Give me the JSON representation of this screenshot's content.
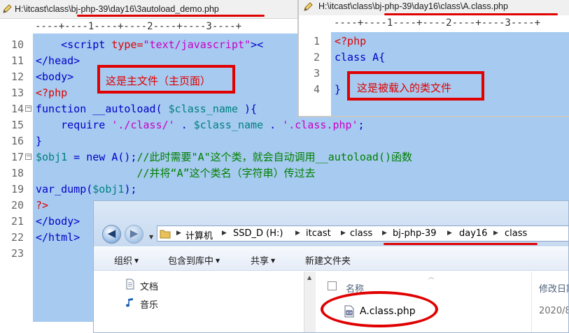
{
  "editor_main": {
    "title": "H:\\itcast\\class\\bj-php-39\\day16\\3autoload_demo.php",
    "ruler": "----+----1----+----2----+----3----+",
    "annotation": "这是主文件（主页面）",
    "line_numbers": [
      "10",
      "11",
      "12",
      "13",
      "14",
      "15",
      "16",
      "17",
      "18",
      "19",
      "20",
      "21",
      "22",
      "23"
    ],
    "lines": {
      "l10_indent": "    ",
      "l10_tag": "<script ",
      "l10_attr": "type=",
      "l10_str": "\"text/javascript\"",
      "l10_end": "><",
      "l11": "</head>",
      "l12": "<body>",
      "l13": "<?php",
      "l14_kw": "function",
      "l14_fn": " __autoload( ",
      "l14_var": "$class_name",
      "l14_end": " ){",
      "l15_kw": "    require ",
      "l15_str1": "'./class/'",
      "l15_dot": " . ",
      "l15_var": "$class_name",
      "l15_dot2": " . ",
      "l15_str2": "'.class.php'",
      "l15_end": ";",
      "l16": "}",
      "l17_var": "$obj1",
      "l17_mid": " = new A();",
      "l17_cmt": "//此时需要\"A\"这个类，就会自动调用__autoload()函数",
      "l18_cmt": "                //并将“A”这个类名（字符串）传过去",
      "l19_fn": "var_dump(",
      "l19_var": "$obj1",
      "l19_end": ");",
      "l20": "?>",
      "l21": "</body>",
      "l22": "</html>"
    }
  },
  "editor_class": {
    "title": "H:\\itcast\\class\\bj-php-39\\day16\\class\\A.class.php",
    "ruler": "----+----1----+----2----+----3----+",
    "line_numbers": [
      "1",
      "2",
      "3",
      "4"
    ],
    "lines": {
      "l1": "<?php",
      "l2": "class A{",
      "l4": "}"
    },
    "annotation": "这是被载入的类文件"
  },
  "explorer": {
    "breadcrumbs": [
      "计算机",
      "SSD_D (H:)",
      "itcast",
      "class",
      "bj-php-39",
      "day16",
      "class"
    ],
    "toolbar": [
      "组织",
      "包含到库中",
      "共享",
      "新建文件夹"
    ],
    "nav_items": [
      "文档",
      "音乐"
    ],
    "column_name": "名称",
    "column_date": "修改日期",
    "file_name": "A.class.php",
    "file_date": "2020/8"
  },
  "colors": {
    "code_bg": "#a6caf0",
    "annotation_red": "#e00000",
    "keyword": "#0000c8",
    "string": "#c800c8",
    "variable": "#008080",
    "comment": "#008000"
  }
}
